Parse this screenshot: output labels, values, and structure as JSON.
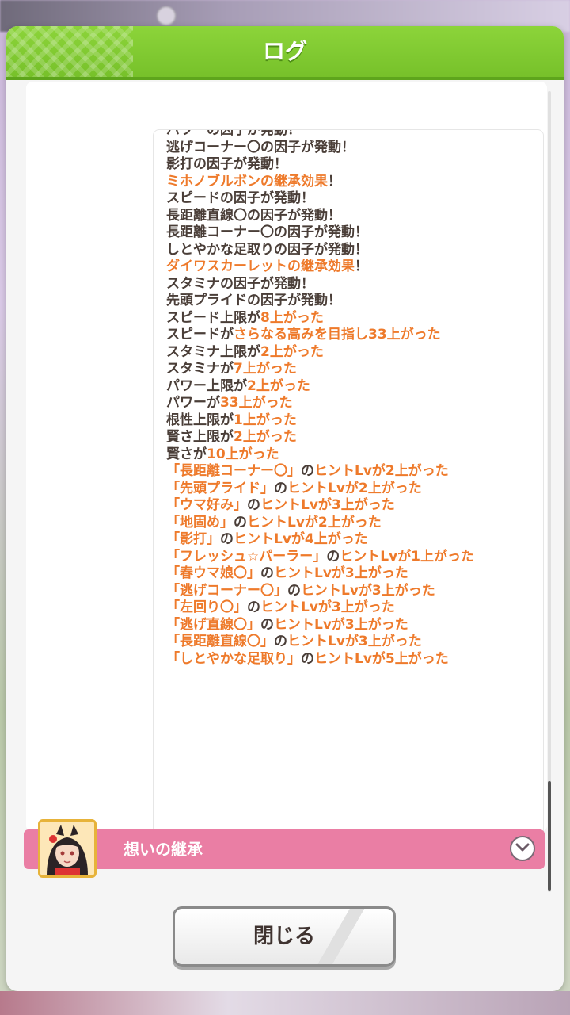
{
  "modal": {
    "title": "ログ"
  },
  "log": {
    "lines": [
      [
        [
          "n",
          "パワーの因子が発動！"
        ]
      ],
      [
        [
          "n",
          "逃げコーナー〇の因子が発動！"
        ]
      ],
      [
        [
          "n",
          "影打の因子が発動！"
        ]
      ],
      [
        [
          "h",
          "ミホノブルボンの継承効果"
        ],
        [
          "n",
          "！"
        ]
      ],
      [
        [
          "n",
          "スピードの因子が発動！"
        ]
      ],
      [
        [
          "n",
          "長距離直線〇の因子が発動！"
        ]
      ],
      [
        [
          "n",
          "長距離コーナー〇の因子が発動！"
        ]
      ],
      [
        [
          "n",
          "しとやかな足取りの因子が発動！"
        ]
      ],
      [
        [
          "h",
          "ダイワスカーレットの継承効果"
        ],
        [
          "n",
          "！"
        ]
      ],
      [
        [
          "n",
          "スタミナの因子が発動！"
        ]
      ],
      [
        [
          "n",
          "先頭プライドの因子が発動！"
        ]
      ],
      [
        [
          "n",
          "スピード上限が"
        ],
        [
          "h",
          "8上がった"
        ]
      ],
      [
        [
          "n",
          "スピードが"
        ],
        [
          "h",
          "さらなる高みを目指し33上がった"
        ]
      ],
      [
        [
          "n",
          "スタミナ上限が"
        ],
        [
          "h",
          "2上がった"
        ]
      ],
      [
        [
          "n",
          "スタミナが"
        ],
        [
          "h",
          "7上がった"
        ]
      ],
      [
        [
          "n",
          "パワー上限が"
        ],
        [
          "h",
          "2上がった"
        ]
      ],
      [
        [
          "n",
          "パワーが"
        ],
        [
          "h",
          "33上がった"
        ]
      ],
      [
        [
          "n",
          "根性上限が"
        ],
        [
          "h",
          "1上がった"
        ]
      ],
      [
        [
          "n",
          "賢さ上限が"
        ],
        [
          "h",
          "2上がった"
        ]
      ],
      [
        [
          "n",
          "賢さが"
        ],
        [
          "h",
          "10上がった"
        ]
      ],
      [
        [
          "h",
          "「長距離コーナー〇」"
        ],
        [
          "n",
          "の"
        ],
        [
          "h",
          "ヒントLvが2上がった"
        ]
      ],
      [
        [
          "h",
          "「先頭プライド」"
        ],
        [
          "n",
          "の"
        ],
        [
          "h",
          "ヒントLvが2上がった"
        ]
      ],
      [
        [
          "h",
          "「ウマ好み」"
        ],
        [
          "n",
          "の"
        ],
        [
          "h",
          "ヒントLvが3上がった"
        ]
      ],
      [
        [
          "h",
          "「地固め」"
        ],
        [
          "n",
          "の"
        ],
        [
          "h",
          "ヒントLvが2上がった"
        ]
      ],
      [
        [
          "h",
          "「影打」"
        ],
        [
          "n",
          "の"
        ],
        [
          "h",
          "ヒントLvが4上がった"
        ]
      ],
      [
        [
          "h",
          "「フレッシュ☆パーラー」"
        ],
        [
          "n",
          "の"
        ],
        [
          "h",
          "ヒントLvが1上がった"
        ]
      ],
      [
        [
          "h",
          "「春ウマ娘〇」"
        ],
        [
          "n",
          "の"
        ],
        [
          "h",
          "ヒントLvが3上がった"
        ]
      ],
      [
        [
          "h",
          "「逃げコーナー〇」"
        ],
        [
          "n",
          "の"
        ],
        [
          "h",
          "ヒントLvが3上がった"
        ]
      ],
      [
        [
          "h",
          "「左回り〇」"
        ],
        [
          "n",
          "の"
        ],
        [
          "h",
          "ヒントLvが3上がった"
        ]
      ],
      [
        [
          "h",
          "「逃げ直線〇」"
        ],
        [
          "n",
          "の"
        ],
        [
          "h",
          "ヒントLvが3上がった"
        ]
      ],
      [
        [
          "h",
          "「長距離直線〇」"
        ],
        [
          "n",
          "の"
        ],
        [
          "h",
          "ヒントLvが3上がった"
        ]
      ],
      [
        [
          "h",
          "「しとやかな足取り」"
        ],
        [
          "n",
          "の"
        ],
        [
          "h",
          "ヒントLvが5上がった"
        ]
      ]
    ]
  },
  "inherit": {
    "label": "想いの継承"
  },
  "close": {
    "label": "閉じる"
  },
  "colors": {
    "header": "#7ac52c",
    "highlight": "#ee7a2b",
    "text": "#4a3e38",
    "inherit_bar": "#ea7ea4"
  },
  "icons": {
    "expand": "chevron-down-icon",
    "avatar": "character-portrait"
  }
}
